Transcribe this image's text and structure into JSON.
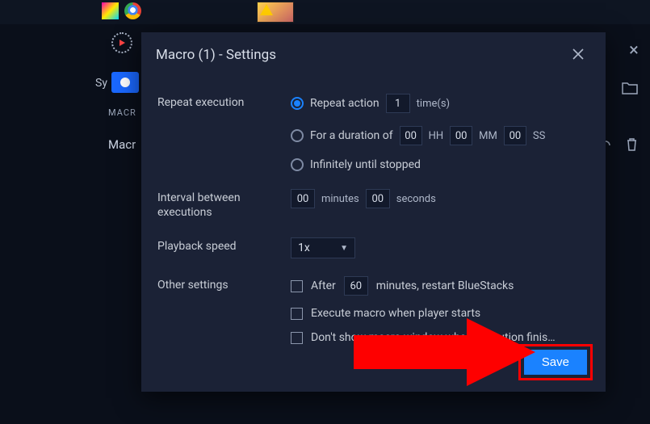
{
  "bg": {
    "sy": "Sy",
    "macr_small": "MACR",
    "macr_title": "Macr"
  },
  "dialog": {
    "title": "Macro (1) - Settings"
  },
  "repeat": {
    "label": "Repeat execution",
    "opt1_text": "Repeat action",
    "opt1_value": "1",
    "opt1_suffix": "time(s)",
    "opt2_text": "For a duration of",
    "opt2_hh": "00",
    "opt2_mm": "00",
    "opt2_ss": "00",
    "hh_label": "HH",
    "mm_label": "MM",
    "ss_label": "SS",
    "opt3_text": "Infinitely until stopped"
  },
  "interval": {
    "label": "Interval between executions",
    "minutes_value": "00",
    "minutes_label": "minutes",
    "seconds_value": "00",
    "seconds_label": "seconds"
  },
  "speed": {
    "label": "Playback speed",
    "value": "1x"
  },
  "other": {
    "label": "Other settings",
    "opt1_pre": "After",
    "opt1_value": "60",
    "opt1_post": "minutes, restart BlueStacks",
    "opt2": "Execute macro when player starts",
    "opt3": "Don't show macro window when execution finis…"
  },
  "save": "Save"
}
